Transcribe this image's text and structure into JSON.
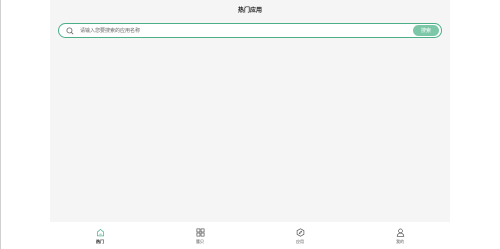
{
  "header": {
    "title": "热门应用"
  },
  "search": {
    "placeholder": "请输入您要搜索的应用名称",
    "value": "",
    "button_label": "搜索"
  },
  "tabbar": {
    "items": [
      {
        "label": "热门",
        "icon": "home-icon",
        "active": true
      },
      {
        "label": "腰贝",
        "icon": "grid-icon",
        "active": false
      },
      {
        "label": "应用",
        "icon": "compass-icon",
        "active": false
      },
      {
        "label": "我的",
        "icon": "user-icon",
        "active": false
      }
    ]
  },
  "colors": {
    "accent": "#4caf88",
    "button_bg": "#7cc7a8",
    "content_bg": "#f5f5f5"
  }
}
